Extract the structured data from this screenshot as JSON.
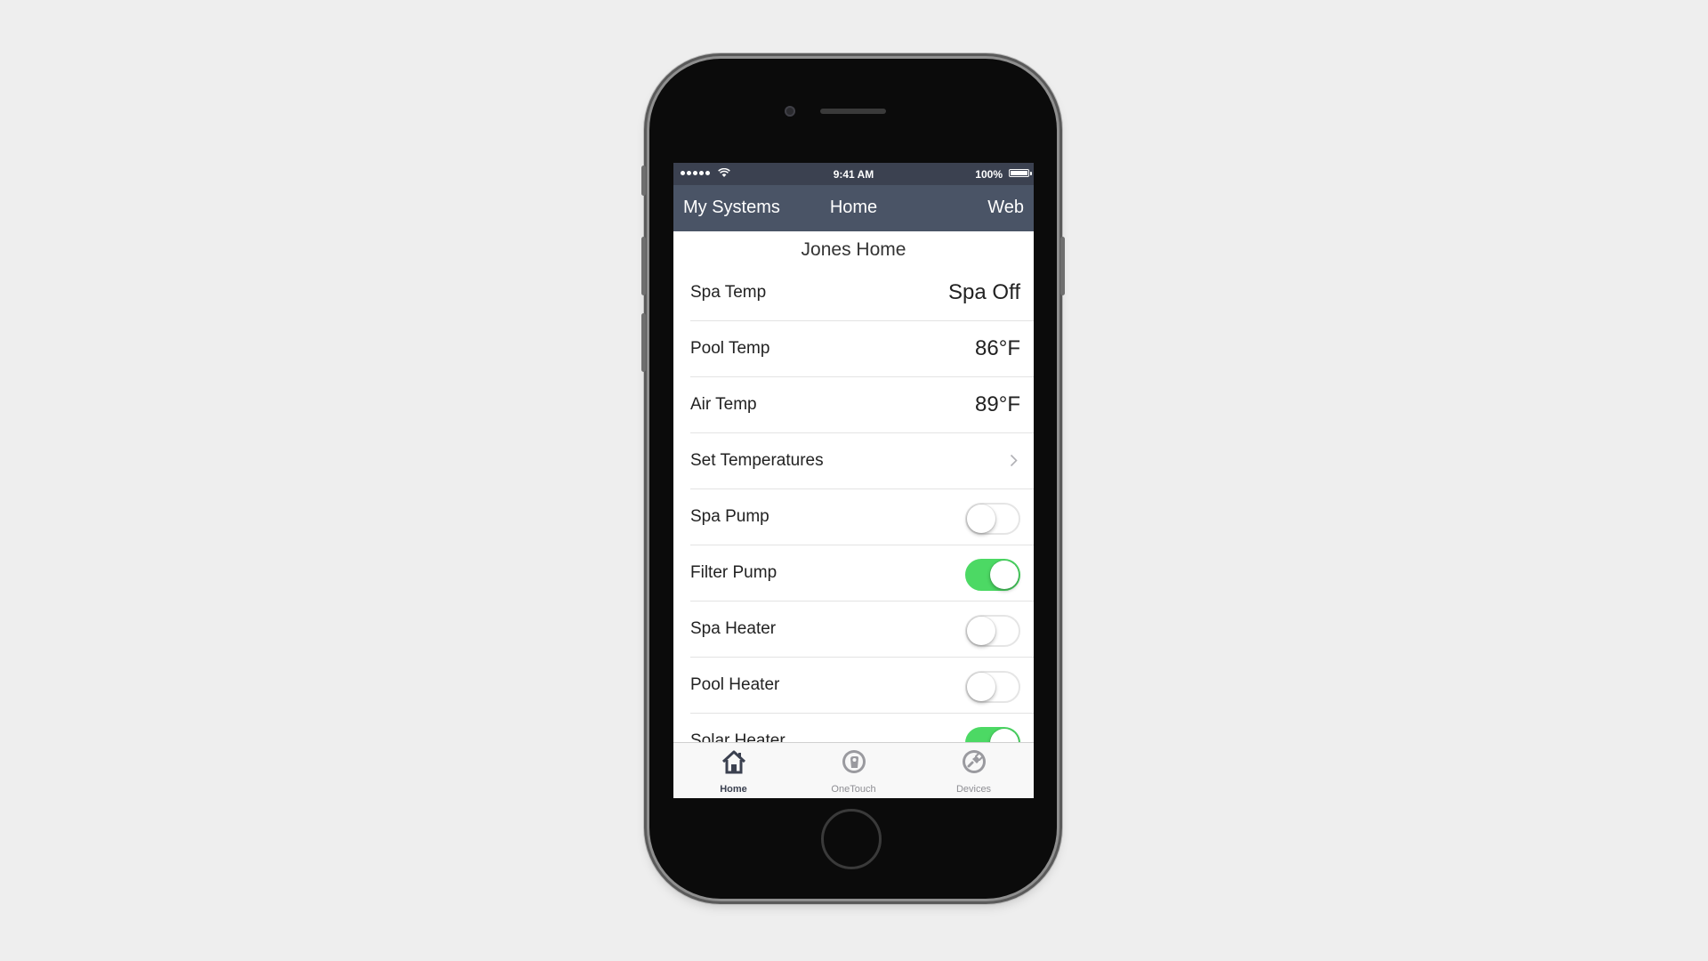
{
  "status_bar": {
    "time": "9:41 AM",
    "battery": "100%"
  },
  "nav": {
    "left": "My Systems",
    "title": "Home",
    "right": "Web"
  },
  "system_name": "Jones Home",
  "rows": [
    {
      "label": "Spa Temp",
      "value": "Spa Off"
    },
    {
      "label": "Pool Temp",
      "value": "86°F"
    },
    {
      "label": "Air Temp",
      "value": "89°F"
    },
    {
      "label": "Set Temperatures"
    },
    {
      "label": "Spa Pump",
      "toggle": "off"
    },
    {
      "label": "Filter Pump",
      "toggle": "on"
    },
    {
      "label": "Spa Heater",
      "toggle": "off"
    },
    {
      "label": "Pool Heater",
      "toggle": "off"
    },
    {
      "label": "Solar Heater",
      "toggle": "on"
    }
  ],
  "tabs": [
    {
      "label": "Home",
      "icon": "home-icon",
      "active": true
    },
    {
      "label": "OneTouch",
      "icon": "onetouch-icon",
      "active": false
    },
    {
      "label": "Devices",
      "icon": "devices-icon",
      "active": false
    }
  ],
  "colors": {
    "nav": "#4a5466",
    "status": "#3b4150",
    "toggle_on": "#4cd964"
  }
}
